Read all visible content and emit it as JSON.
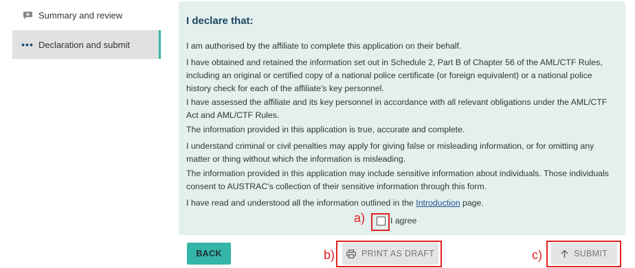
{
  "sidebar": {
    "items": [
      {
        "label": "Summary and review",
        "icon": "add-comment-icon",
        "state": "normal"
      },
      {
        "label": "Declaration and submit",
        "icon": "ellipsis-icon",
        "state": "current"
      }
    ]
  },
  "declaration": {
    "title": "I declare that:",
    "statements": [
      "I am authorised by the affiliate to complete this application on their behalf.",
      "I have obtained and retained the information set out in Schedule 2, Part B of Chapter 56 of the AML/CTF Rules, including an original or certified copy of a national police certificate (or foreign equivalent) or a national police history check for each of the affiliate's key personnel.",
      "I have assessed the affiliate and its key personnel in accordance with all relevant obligations under the AML/CTF Act and AML/CTF Rules.",
      "The information provided in this application is true, accurate and complete.",
      "I understand criminal or civil penalties may apply for giving false or misleading information, or for omitting any matter or thing without which the information is misleading.",
      "The information provided in this application may include sensitive information about individuals. Those individuals consent to AUSTRAC's collection of their sensitive information through this form."
    ],
    "last_statement": {
      "before": "I have read and understood all the information outlined in the ",
      "link": "Introduction",
      "after": " page."
    },
    "agree_label": "I agree",
    "agree_checked": false
  },
  "buttons": {
    "back": "BACK",
    "print": "PRINT AS DRAFT",
    "submit": "SUBMIT"
  },
  "annotations": {
    "a": "a)",
    "b": "b)",
    "c": "c)"
  },
  "colors": {
    "accent": "#33b6a8",
    "panel_bg": "#e3f0ee",
    "annotation": "#e02020",
    "title": "#1d4560"
  }
}
